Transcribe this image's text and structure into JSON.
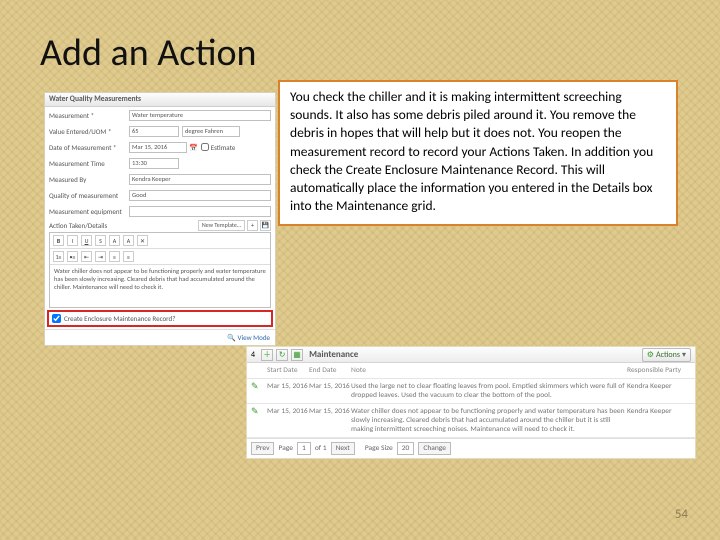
{
  "slide": {
    "title": "Add an Action",
    "page_number": "54"
  },
  "callout": {
    "text": "You check the chiller and it is making intermittent screeching sounds. It also has some debris piled around it. You remove the debris in hopes that will help but it does not. You reopen the measurement record to record your Actions Taken. In addition you check the Create Enclosure Maintenance Record. This will automatically place the information you entered in the Details box into the Maintenance grid."
  },
  "form": {
    "header": "Water Quality Measurements",
    "rows": {
      "measurement": {
        "label": "Measurement *",
        "value": "Water temperature"
      },
      "value_entered": {
        "label": "Value Entered/UOM *",
        "value": "65",
        "uom": "degree Fahren"
      },
      "date": {
        "label": "Date of Measurement *",
        "value": "Mar 15, 2016",
        "estimate": "Estimate"
      },
      "time": {
        "label": "Measurement Time",
        "value": "13:30"
      },
      "measured_by": {
        "label": "Measured By",
        "value": "Kendra Keeper"
      },
      "quality": {
        "label": "Quality of measurement",
        "value": "Good"
      },
      "equipment": {
        "label": "Measurement equipment",
        "value": ""
      },
      "action_label": "Action Taken/Details"
    },
    "rte": {
      "template": "New Template…",
      "body": "Water chiller does not appear to be functioning properly and water temperature has been slowly increasing. Cleared debris that had accumulated around the chiller. Maintenance will need to check it."
    },
    "checkbox_label": "Create Enclosure Maintenance Record?",
    "view_mode": "View Mode"
  },
  "grid": {
    "title": "Maintenance",
    "tab_number": "4",
    "actions_label": "Actions",
    "headers": {
      "start": "Start Date",
      "end": "End Date",
      "note": "Note",
      "resp": "Responsible Party"
    },
    "rows": [
      {
        "start": "Mar 15, 2016",
        "end": "Mar 15, 2016",
        "note": "Used the large net to clear floating leaves from pool. Emptied skimmers which were full of dropped leaves. Used the vacuum to clear the bottom of the pool.",
        "resp": "Kendra Keeper"
      },
      {
        "start": "Mar 15, 2016",
        "end": "Mar 15, 2016",
        "note": "Water chiller does not appear to be functioning properly and water temperature has been slowly increasing. Cleared debris that had accumulated around the chiller but it is still making intermittent screeching noises. Maintenance will need to check it.",
        "resp": "Kendra Keeper"
      }
    ],
    "pager": {
      "prev": "Prev",
      "page_label": "Page",
      "page": "1",
      "of": "of 1",
      "next": "Next",
      "size_label": "Page Size",
      "size": "20",
      "change": "Change"
    }
  }
}
